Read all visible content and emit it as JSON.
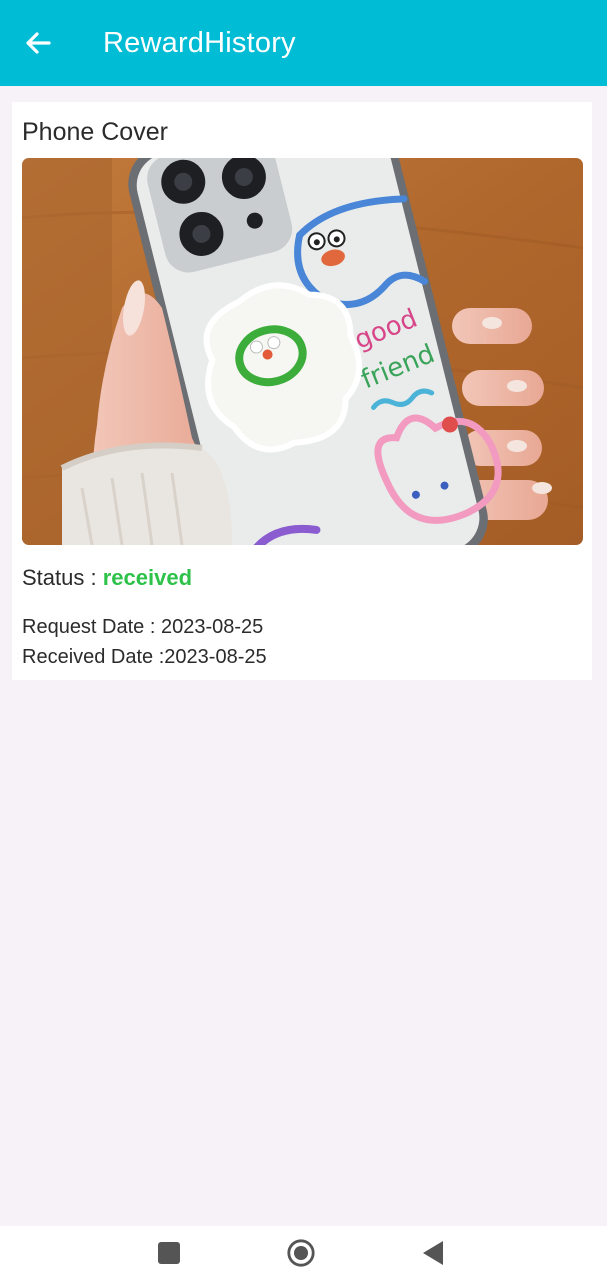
{
  "app_bar": {
    "title": "RewardHistory",
    "back_icon": "arrow-left-icon",
    "background": "#00bcd4"
  },
  "reward_item": {
    "title": "Phone Cover",
    "image_icon": "phone-cover-photo",
    "status_label": "Status : ",
    "status_value": "received",
    "status_color": "#2ec24a",
    "request_date_label": "Request Date : 2023-08-25",
    "received_date_label": "Received Date :2023-08-25"
  },
  "nav_bar": {
    "recents_icon": "square-icon",
    "home_icon": "circle-home-icon",
    "back_icon": "triangle-back-icon"
  }
}
